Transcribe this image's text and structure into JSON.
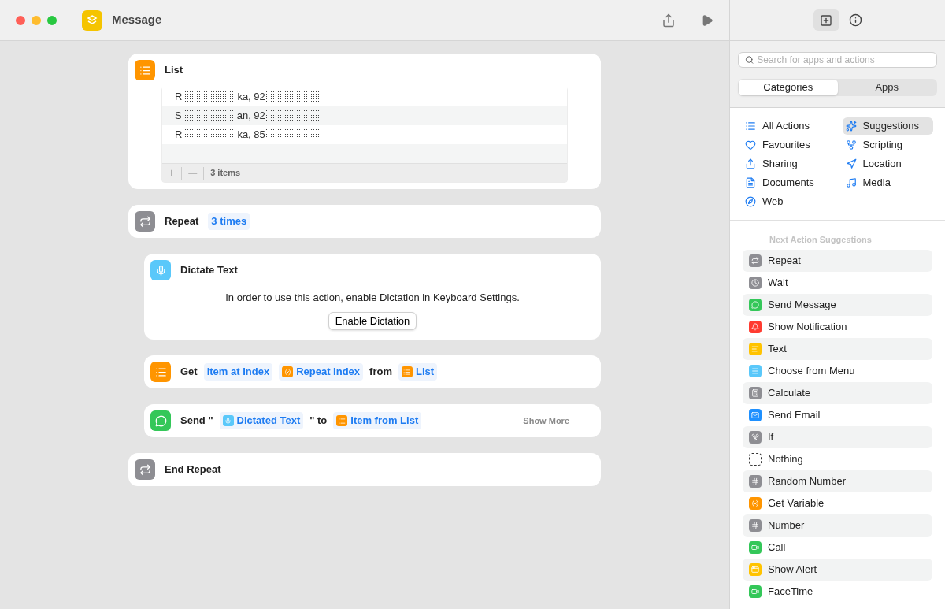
{
  "window": {
    "title": "Message"
  },
  "actions": [
    {
      "kind": "list",
      "title": "List",
      "rows": [
        {
          "parts": [
            "R",
            "ka, 92"
          ]
        },
        {
          "parts": [
            "S",
            "an, 92"
          ]
        },
        {
          "parts": [
            "R",
            "ka, 85"
          ]
        }
      ],
      "footer": {
        "add": "+",
        "remove": "—",
        "count": "3 items"
      }
    },
    {
      "kind": "repeat",
      "title": "Repeat",
      "token": "3 times"
    },
    {
      "kind": "dictate",
      "title": "Dictate Text",
      "message": "In order to use this action, enable Dictation in Keyboard Settings.",
      "button": "Enable Dictation"
    },
    {
      "kind": "get",
      "segments": [
        {
          "kind": "text",
          "text": "Get"
        },
        {
          "kind": "token",
          "text": "Item at Index"
        },
        {
          "kind": "variable",
          "text": "Repeat Index"
        },
        {
          "kind": "text",
          "text": "from"
        },
        {
          "kind": "list",
          "text": "List"
        }
      ]
    },
    {
      "kind": "send",
      "segments": [
        {
          "kind": "text",
          "text": "Send \""
        },
        {
          "kind": "dictated",
          "text": "Dictated Text"
        },
        {
          "kind": "text",
          "text": "\" to"
        },
        {
          "kind": "listitem",
          "text": "Item from List"
        }
      ],
      "more": "Show More"
    },
    {
      "kind": "end",
      "title": "End Repeat"
    }
  ],
  "sidebar": {
    "search": {
      "placeholder": "Search for apps and actions"
    },
    "segments": [
      {
        "label": "Categories",
        "selected": true
      },
      {
        "label": "Apps",
        "selected": false
      }
    ],
    "categories": [
      {
        "label": "All Actions",
        "selected": false
      },
      {
        "label": "Suggestions",
        "selected": true
      },
      {
        "label": "Favourites",
        "selected": false
      },
      {
        "label": "Scripting",
        "selected": false
      },
      {
        "label": "Sharing",
        "selected": false
      },
      {
        "label": "Location",
        "selected": false
      },
      {
        "label": "Documents",
        "selected": false
      },
      {
        "label": "Media",
        "selected": false
      },
      {
        "label": "Web",
        "selected": false
      }
    ],
    "suggestions_heading": "Next Action Suggestions",
    "suggestions": [
      {
        "label": "Repeat",
        "color": "#8e8e93"
      },
      {
        "label": "Wait",
        "color": "#8e8e93"
      },
      {
        "label": "Send Message",
        "color": "#34c759"
      },
      {
        "label": "Show Notification",
        "color": "#ff3b30"
      },
      {
        "label": "Text",
        "color": "#ffc300"
      },
      {
        "label": "Choose from Menu",
        "color": "#5ac8fa"
      },
      {
        "label": "Calculate",
        "color": "#8e8e93"
      },
      {
        "label": "Send Email",
        "color": "#1e90ff"
      },
      {
        "label": "If",
        "color": "#8e8e93"
      },
      {
        "label": "Nothing",
        "color": "#ffffff"
      },
      {
        "label": "Random Number",
        "color": "#8e8e93"
      },
      {
        "label": "Get Variable",
        "color": "#ff9500"
      },
      {
        "label": "Number",
        "color": "#8e8e93"
      },
      {
        "label": "Call",
        "color": "#34c759"
      },
      {
        "label": "Show Alert",
        "color": "#ffc300"
      },
      {
        "label": "FaceTime",
        "color": "#34c759"
      }
    ]
  }
}
